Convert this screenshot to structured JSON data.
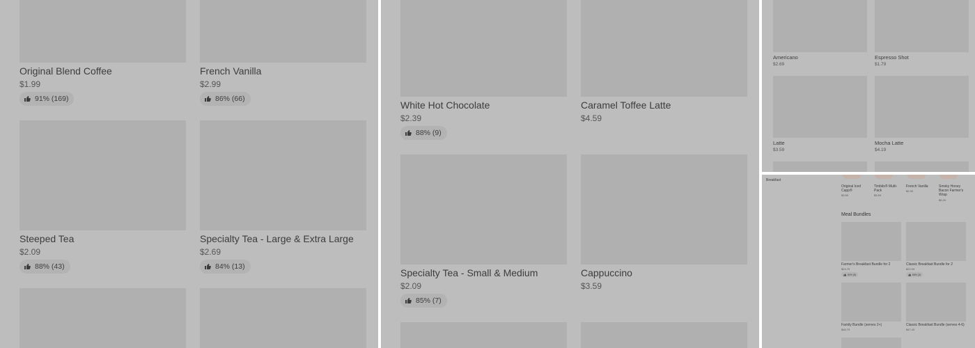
{
  "panel1": {
    "items": [
      {
        "name": "Original Blend Coffee",
        "price": "$1.99",
        "rating": "91% (169)"
      },
      {
        "name": "French Vanilla",
        "price": "$2.99",
        "rating": "86% (66)"
      },
      {
        "name": "Steeped Tea",
        "price": "$2.09",
        "rating": "88% (43)"
      },
      {
        "name": "Specialty Tea - Large & Extra Large",
        "price": "$2.69",
        "rating": "84% (13)"
      }
    ]
  },
  "panel2": {
    "items": [
      {
        "name": "White Hot Chocolate",
        "price": "$2.39",
        "rating": "88% (9)"
      },
      {
        "name": "Caramel Toffee Latte",
        "price": "$4.59"
      },
      {
        "name": "Specialty Tea - Small & Medium",
        "price": "$2.09",
        "rating": "85% (7)"
      },
      {
        "name": "Cappuccino",
        "price": "$3.59"
      }
    ]
  },
  "panel3": {
    "items": [
      {
        "name": "Americano",
        "price": "$2.69"
      },
      {
        "name": "Espresso Shot",
        "price": "$1.79"
      },
      {
        "name": "Latte",
        "price": "$3.59"
      },
      {
        "name": "Mocha Latte",
        "price": "$4.19"
      }
    ]
  },
  "panel4": {
    "sidebar_label": "Breakfast",
    "top_items": [
      {
        "name": "Original Iced Capp®",
        "price": "$3.59"
      },
      {
        "name": "Timbits® Multi-Pack",
        "price": "$3.59"
      },
      {
        "name": "French Vanilla",
        "price": "$2.99"
      },
      {
        "name": "Smoky Honey Bacon Farmer's Wrap",
        "price": "$5.29"
      }
    ],
    "section_title": "Meal Bundles",
    "bundles": [
      {
        "name": "Farmer's Breakfast Bundle for 2",
        "price": "$24.79",
        "rating": "80% (5)"
      },
      {
        "name": "Classic Breakfast Bundle for 2",
        "price": "$22.09",
        "rating": "68% (3)"
      },
      {
        "name": "Family Bundle (serves 2+)",
        "price": "$46.79"
      },
      {
        "name": "Classic Breakfast Bundle (serves 4-6)",
        "price": "$47.49"
      }
    ]
  },
  "icons": {
    "rating": "thumbs-up-icon"
  },
  "colors": {
    "overlay": "#bdbdbd",
    "thumb": "#b0b0b0",
    "divider": "#ffffff"
  }
}
